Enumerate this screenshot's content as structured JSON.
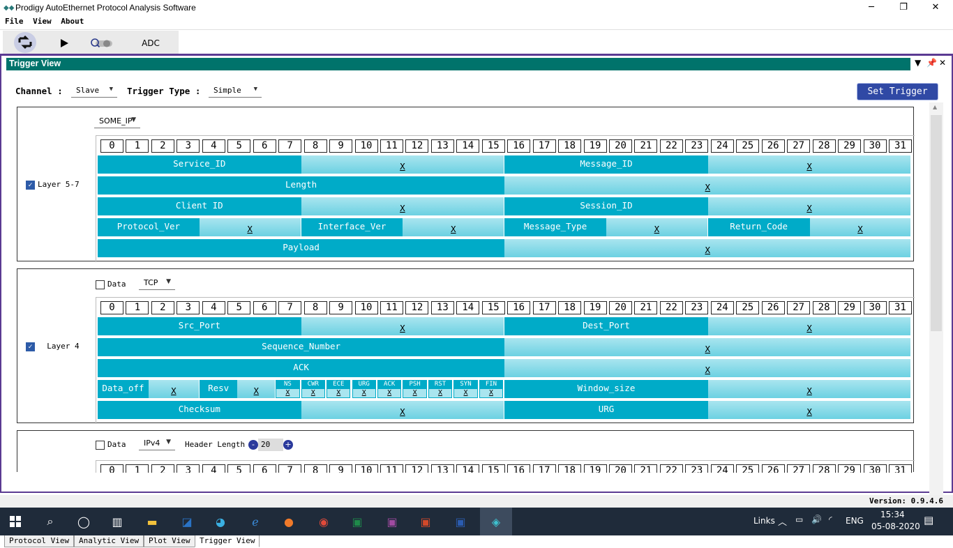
{
  "window": {
    "title": "Prodigy AutoEthernet Protocol Analysis Software",
    "minimize": "─",
    "maximize": "❐",
    "close": "✕"
  },
  "menu": [
    "File",
    "View",
    "About"
  ],
  "toolbar": {
    "adc_label": "ADC",
    "icons": [
      "swap-icon",
      "play-icon",
      "search-toggle-icon"
    ]
  },
  "panel": {
    "title": "Trigger View"
  },
  "controls": {
    "channel_label": "Channel :",
    "channel_value": "Slave",
    "trigger_type_label": "Trigger Type :",
    "trigger_type_value": "Simple",
    "set_trigger_label": "Set Trigger"
  },
  "bits": [
    "0",
    "1",
    "2",
    "3",
    "4",
    "5",
    "6",
    "7",
    "8",
    "9",
    "10",
    "11",
    "12",
    "13",
    "14",
    "15",
    "16",
    "17",
    "18",
    "19",
    "20",
    "21",
    "22",
    "23",
    "24",
    "25",
    "26",
    "27",
    "28",
    "29",
    "30",
    "31"
  ],
  "layer57": {
    "checked": true,
    "label": "Layer 5-7",
    "protocol": "SOME_IP",
    "rows": [
      [
        {
          "name": "Service_ID",
          "bits": 16,
          "value": "X"
        },
        {
          "name": "Message_ID",
          "bits": 16,
          "value": "X"
        }
      ],
      [
        {
          "name": "Length",
          "bits": 32,
          "value": "X"
        }
      ],
      [
        {
          "name": "Client ID",
          "bits": 16,
          "value": "X"
        },
        {
          "name": "Session_ID",
          "bits": 16,
          "value": "X"
        }
      ],
      [
        {
          "name": "Protocol_Ver",
          "bits": 8,
          "value": "X"
        },
        {
          "name": "Interface_Ver",
          "bits": 8,
          "value": "X"
        },
        {
          "name": "Message_Type",
          "bits": 8,
          "value": "X"
        },
        {
          "name": "Return_Code",
          "bits": 8,
          "value": "X"
        }
      ],
      [
        {
          "name": "Payload",
          "bits": 32,
          "value": "X"
        }
      ]
    ]
  },
  "layer4": {
    "checked": true,
    "label": "Layer 4",
    "data_label": "Data",
    "data_checked": false,
    "protocol": "TCP",
    "rows": [
      [
        {
          "name": "Src_Port",
          "bits": 16,
          "value": "X"
        },
        {
          "name": "Dest_Port",
          "bits": 16,
          "value": "X"
        }
      ],
      [
        {
          "name": "Sequence_Number",
          "bits": 32,
          "value": "X"
        }
      ],
      [
        {
          "name": "ACK",
          "bits": 32,
          "value": "X"
        }
      ],
      [
        {
          "name": "Checksum",
          "bits": 16,
          "value": "X"
        },
        {
          "name": "URG",
          "bits": 16,
          "value": "X"
        }
      ]
    ],
    "flags_row": {
      "data_off": {
        "name": "Data_off",
        "value": "X"
      },
      "resv": {
        "name": "Resv",
        "value": "X"
      },
      "flags": [
        {
          "name": "NS",
          "value": "X"
        },
        {
          "name": "CWR",
          "value": "X"
        },
        {
          "name": "ECE",
          "value": "X"
        },
        {
          "name": "URG",
          "value": "X"
        },
        {
          "name": "ACK",
          "value": "X"
        },
        {
          "name": "PSH",
          "value": "X"
        },
        {
          "name": "RST",
          "value": "X"
        },
        {
          "name": "SYN",
          "value": "X"
        },
        {
          "name": "FIN",
          "value": "X"
        }
      ],
      "window": {
        "name": "Window_size",
        "value": "X"
      }
    }
  },
  "layer3": {
    "data_label": "Data",
    "data_checked": false,
    "protocol": "IPv4",
    "header_length_label": "Header Length",
    "header_length_value": "20",
    "minus": "-",
    "plus": "+"
  },
  "tabs": [
    "Protocol View",
    "Analytic View",
    "Plot View",
    "Trigger View"
  ],
  "active_tab": "Trigger View",
  "status": {
    "version": "Version: 0.9.4.6"
  },
  "taskbar": {
    "links": "Links",
    "lang": "ENG",
    "time": "15:34",
    "date": "05-08-2020"
  },
  "colors": {
    "accent": "#00736b",
    "field": "#00abc8",
    "value": "#a9e5ef",
    "button": "#3049a5",
    "border": "#5b3a92"
  }
}
